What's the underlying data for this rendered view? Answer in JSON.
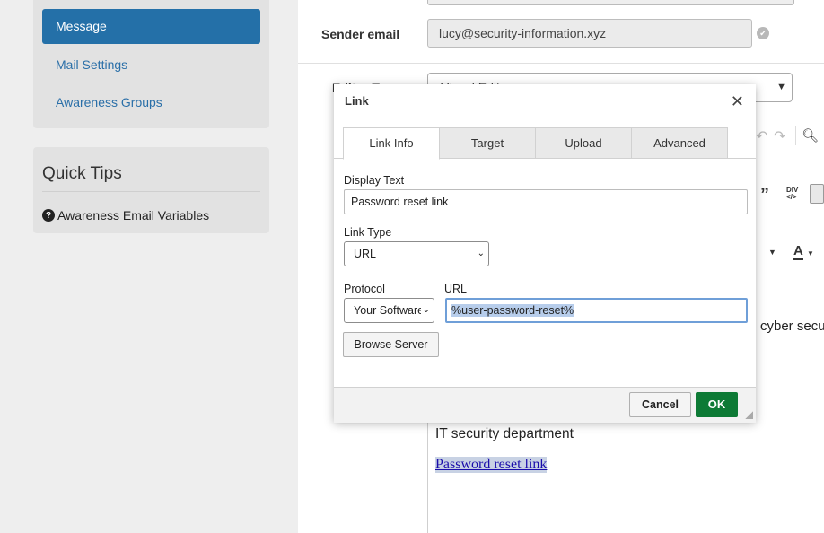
{
  "sidebar": {
    "active_item": "Message",
    "items": [
      "Mail Settings",
      "Awareness Groups"
    ],
    "tips_title": "Quick Tips",
    "tips_item": "Awareness Email Variables"
  },
  "form": {
    "sender_label": "Sender email",
    "sender_value": "lucy@security-information.xyz",
    "editor_label": "Editor Type",
    "editor_value": "Visual Editor"
  },
  "editor": {
    "line_partial": "cyber secu",
    "signature": "IT security department",
    "link_text": "Password reset link"
  },
  "dialog": {
    "title": "Link",
    "tabs": [
      "Link Info",
      "Target",
      "Upload",
      "Advanced"
    ],
    "active_tab": "Link Info",
    "display_text_label": "Display Text",
    "display_text_value": "Password reset link",
    "link_type_label": "Link Type",
    "link_type_value": "URL",
    "protocol_label": "Protocol",
    "protocol_value": "Your Software",
    "url_label": "URL",
    "url_value": "%user-password-reset%",
    "browse_button": "Browse Server",
    "cancel_button": "Cancel",
    "ok_button": "OK",
    "colors": {
      "ok": "#0d7a35",
      "focus": "#6f9fd8",
      "nav_active": "#2470a8"
    }
  }
}
